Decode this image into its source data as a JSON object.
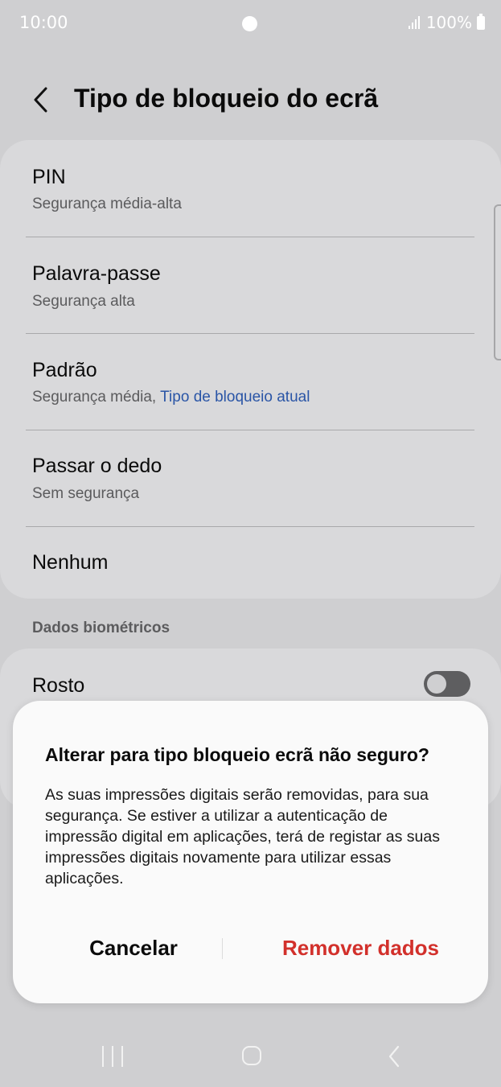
{
  "status_bar": {
    "time": "10:00",
    "battery": "100%",
    "icons": [
      "notification-dot-icon",
      "signal-icon",
      "battery-icon"
    ]
  },
  "header": {
    "title": "Tipo de bloqueio do ecrã",
    "back_icon": "chevron-left-icon"
  },
  "lock_types": [
    {
      "title": "PIN",
      "subtitle": "Segurança média-alta"
    },
    {
      "title": "Palavra-passe",
      "subtitle": "Segurança alta"
    },
    {
      "title": "Padrão",
      "subtitle": "Segurança média,",
      "current_label": "Tipo de bloqueio atual"
    },
    {
      "title": "Passar o dedo",
      "subtitle": "Sem segurança"
    },
    {
      "title": "Nenhum"
    }
  ],
  "biometrics": {
    "section_label": "Dados biométricos",
    "face_label": "Rosto",
    "face_enabled": false
  },
  "dialog": {
    "title": "Alterar para tipo bloqueio ecrã não seguro?",
    "body": "As suas impressões digitais serão removidas, para sua segurança. Se estiver a utilizar a autenticação de impressão digital em aplicações, terá de registar as suas impressões digitais novamente para utilizar essas aplicações.",
    "cancel_label": "Cancelar",
    "confirm_label": "Remover dados",
    "confirm_color": "#d2302b"
  },
  "nav_bar": {
    "icons": [
      "recent-apps-icon",
      "home-icon",
      "back-icon"
    ]
  },
  "colors": {
    "link": "#2a55a6",
    "background": "#cfcfd1"
  }
}
